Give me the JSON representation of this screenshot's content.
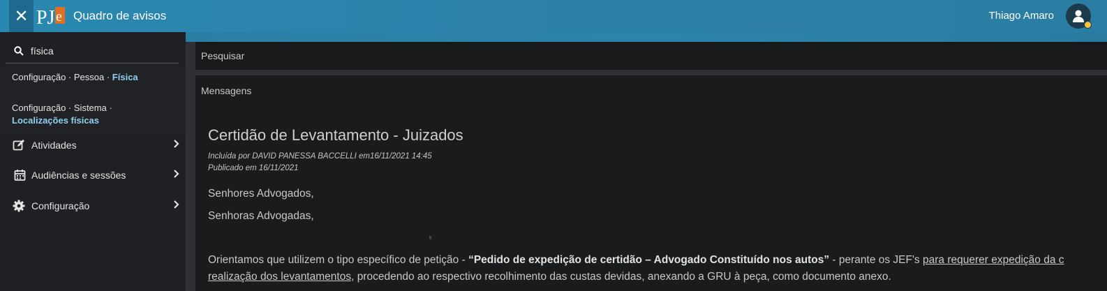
{
  "header": {
    "close_glyph": "✕",
    "logo_text": "PJe",
    "title": "Quadro de avisos",
    "user_name": "Thiago Amaro",
    "accent_color": "#2a88b0",
    "status_dot_color": "#f3c33b"
  },
  "sidebar": {
    "search_value": "física",
    "results": [
      {
        "prefix": "Configuração · Pessoa · ",
        "highlight": "Física"
      },
      {
        "prefix": "Configuração · Sistema · ",
        "highlight": "Localizações físicas"
      }
    ],
    "items": [
      {
        "label": "Atividades",
        "icon": "edit-icon"
      },
      {
        "label": "Audiências e sessões",
        "icon": "calendar-icon"
      },
      {
        "label": "Configuração",
        "icon": "gear-icon"
      }
    ]
  },
  "main": {
    "search_panel_label": "Pesquisar",
    "messages_panel_label": "Mensagens",
    "message": {
      "title": "Certidão de Levantamento - Juizados",
      "included_by": "Incluída por DAVID PANESSA BACCELLI em16/11/2021 14:45",
      "published": "Publicado em 16/11/2021",
      "greeting_1": "Senhores Advogados,",
      "greeting_2": "Senhoras Advogadas,",
      "body_part1": "Orientamos que utilizem o tipo específico de petição - ",
      "body_bold": "“Pedido de expedição de certidão – Advogado Constituído nos autos”",
      "body_part2": " - perante os JEF's ",
      "body_underline1": "para requerer expedição da c",
      "body_underline2": "realização dos levantamentos",
      "body_part3": ", procedendo ao respectivo recolhimento das custas devidas, anexando a GRU à peça, como documento anexo."
    }
  }
}
